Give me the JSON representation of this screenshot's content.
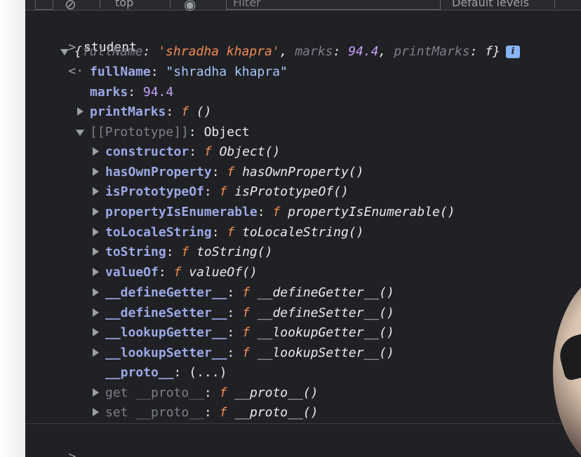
{
  "toolbar": {
    "context": "top",
    "filter_placeholder": "Filter",
    "levels": "Default levels"
  },
  "console": {
    "input_command": "student",
    "summary": {
      "open": "{",
      "fullName_key": "fullName",
      "fullName_val": "'shradha khapra'",
      "marks_key": "marks",
      "marks_val": "94.4",
      "printMarks_key": "printMarks",
      "printMarks_val": "f",
      "close": "}",
      "info": "i"
    },
    "props": [
      {
        "key": "fullName",
        "value": "\"shradha khapra\""
      },
      {
        "key": "marks",
        "value": "94.4"
      },
      {
        "key": "printMarks",
        "value": "()"
      }
    ],
    "prototype_label": "[[Prototype]]",
    "prototype_value": "Object",
    "proto_items": [
      {
        "key": "constructor",
        "fn": "Object()"
      },
      {
        "key": "hasOwnProperty",
        "fn": "hasOwnProperty()"
      },
      {
        "key": "isPrototypeOf",
        "fn": "isPrototypeOf()"
      },
      {
        "key": "propertyIsEnumerable",
        "fn": "propertyIsEnumerable()"
      },
      {
        "key": "toLocaleString",
        "fn": "toLocaleString()"
      },
      {
        "key": "toString",
        "fn": "toString()"
      },
      {
        "key": "valueOf",
        "fn": "valueOf()"
      },
      {
        "key": "__defineGetter__",
        "fn": "__defineGetter__()"
      },
      {
        "key": "__defineSetter__",
        "fn": "__defineSetter__()"
      },
      {
        "key": "__lookupGetter__",
        "fn": "__lookupGetter__()"
      },
      {
        "key": "__lookupSetter__",
        "fn": "__lookupSetter__()"
      }
    ],
    "proto_getter": {
      "key": "__proto__",
      "value": "(...)"
    },
    "accessors": [
      {
        "key": "get __proto__",
        "fn": "__proto__()"
      },
      {
        "key": "set __proto__",
        "fn": "__proto__()"
      }
    ],
    "f_symbol": "f",
    "colon": ":"
  },
  "colors": {
    "background": "#202124",
    "key": "#9ba9e6",
    "string": "#f28b54",
    "number": "#c7a0fa"
  }
}
